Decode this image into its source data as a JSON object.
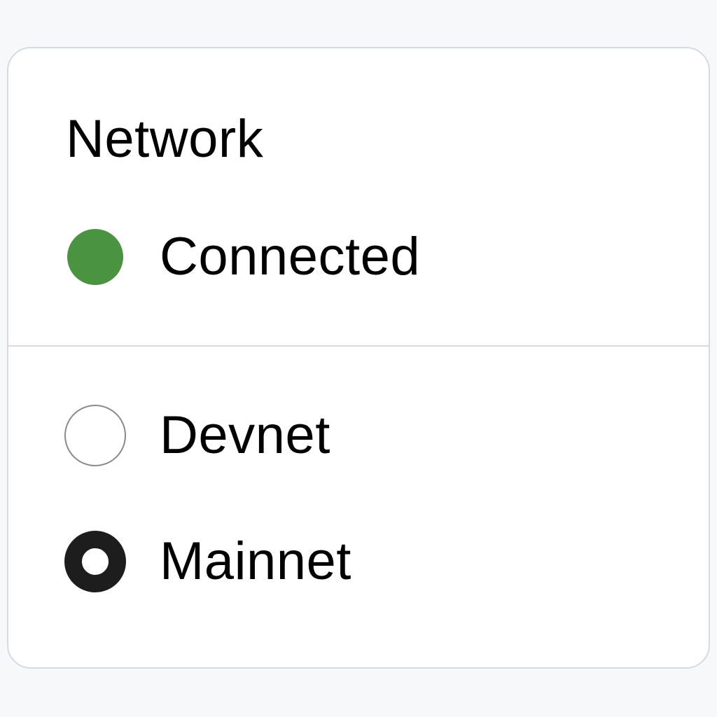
{
  "panel": {
    "title": "Network",
    "status": {
      "label": "Connected",
      "color": "#4a9340"
    },
    "options": [
      {
        "label": "Devnet",
        "selected": false
      },
      {
        "label": "Mainnet",
        "selected": true
      }
    ]
  }
}
